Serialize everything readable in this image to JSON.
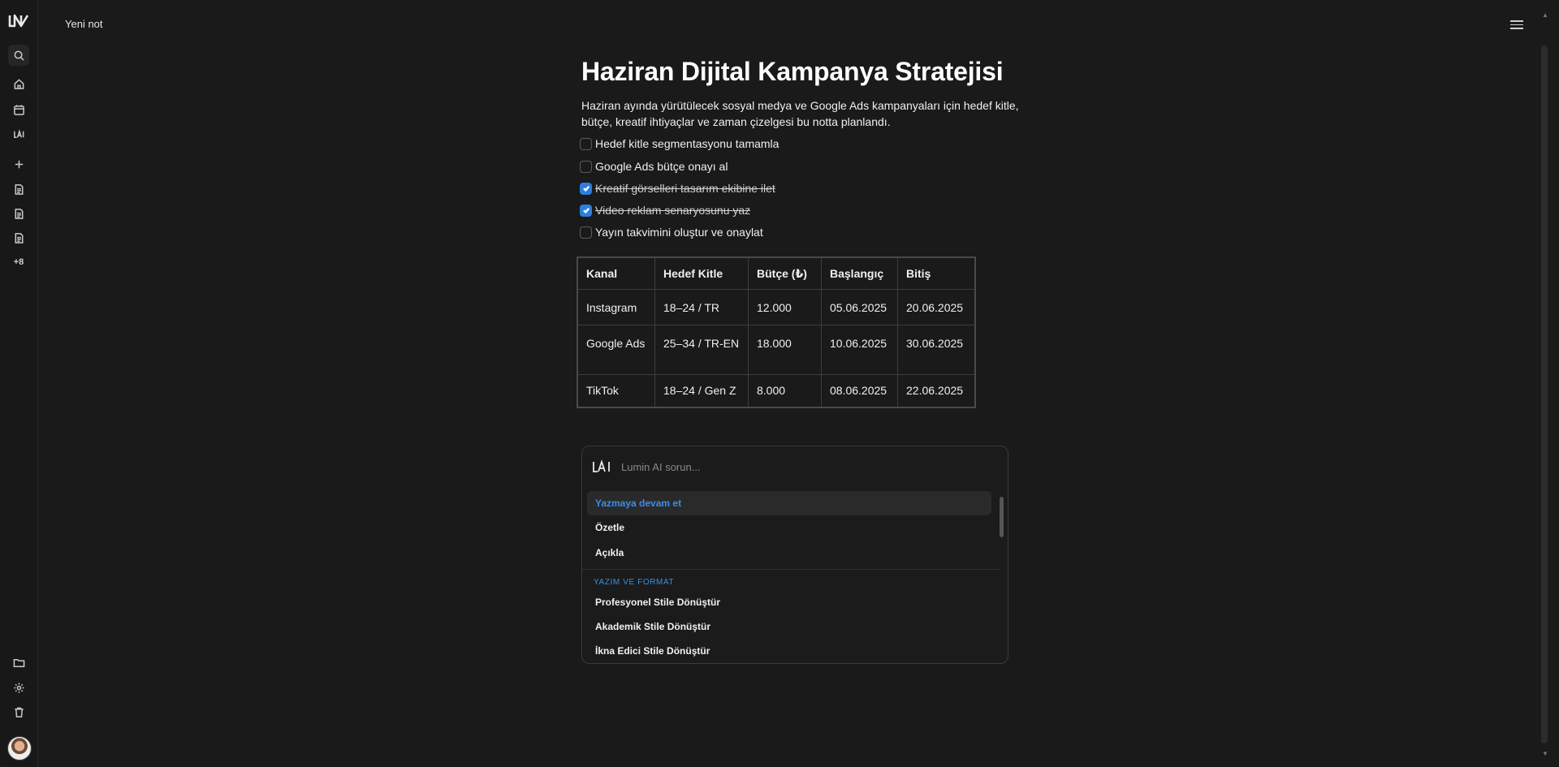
{
  "app": {
    "tab_title": "Yeni not"
  },
  "sidebar": {
    "more_label": "+8"
  },
  "document": {
    "title": "Haziran Dijital Kampanya Stratejisi",
    "description": "Haziran ayında yürütülecek sosyal medya ve Google Ads kampanyaları için hedef kitle, bütçe, kreatif ihtiyaçlar ve zaman çizelgesi bu notta planlandı.",
    "todos": [
      {
        "label": "Hedef kitle segmentasyonu tamamla",
        "checked": false
      },
      {
        "label": "Google Ads bütçe onayı al",
        "checked": false
      },
      {
        "label": "Kreatif görselleri tasarım ekibine ilet",
        "checked": true
      },
      {
        "label": "Video reklam senaryosunu yaz",
        "checked": true
      },
      {
        "label": "Yayın takvimini oluştur ve onaylat",
        "checked": false
      }
    ],
    "table": {
      "headers": [
        "Kanal",
        "Hedef Kitle",
        "Bütçe (₺)",
        "Başlangıç",
        "Bitiş"
      ],
      "rows": [
        [
          "Instagram",
          "18–24 / TR",
          "12.000",
          "05.06.2025",
          "20.06.2025"
        ],
        [
          "Google Ads",
          "25–34 / TR-EN",
          "18.000",
          "10.06.2025",
          "30.06.2025"
        ],
        [
          "TikTok",
          "18–24 / Gen Z",
          "8.000",
          "08.06.2025",
          "22.06.2025"
        ]
      ]
    }
  },
  "ai_panel": {
    "placeholder": "Lumin AI sorun...",
    "items": [
      "Yazmaya devam et",
      "Özetle",
      "Açıkla"
    ],
    "section_title": "YAZIM VE FORMAT",
    "format_items": [
      "Profesyonel Stile Dönüştür",
      "Akademik Stile Dönüştür",
      "İkna Edici Stile Dönüştür"
    ]
  },
  "colors": {
    "accent": "#2b7fe0",
    "background": "#1a1a1a"
  }
}
